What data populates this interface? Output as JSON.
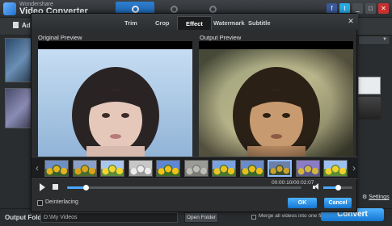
{
  "app": {
    "brand_small": "Wondershare",
    "brand_big": "Video Converter",
    "toolbar": {
      "add_files_label": "Add Fil"
    }
  },
  "editor": {
    "tabs": [
      "Trim",
      "Crop",
      "Effect",
      "Watermark",
      "Subtitle"
    ],
    "active_tab": "Effect",
    "original_label": "Original Preview",
    "output_label": "Output Preview",
    "timecode": "00:00:10/00:02:07",
    "playback_progress": 0.08,
    "volume_level": 0.5,
    "deinterlace_label": "Deinterlacing",
    "ok_label": "OK",
    "cancel_label": "Cancel"
  },
  "effects": [
    "sunflower-blue-sky-effect",
    "sunflower-warm-effect",
    "sunflower-bright-effect",
    "gray-emboss-effect",
    "sunflower-vivid-effect",
    "sketch-effect",
    "sunflower-normal-effect",
    "sunflower-cool-effect",
    "sunflower-selected-effect",
    "sunflower-purple-effect",
    "sunflower-bright-2-effect"
  ],
  "bottom_bar": {
    "output_folder_label": "Output Folder",
    "output_folder_value": "D:\\My Videos",
    "open_folder_label": "Open Folder",
    "merge_label": "Merge all videos into one file",
    "convert_label": "Convert",
    "settings_label": "Settings"
  },
  "colors": {
    "accent": "#1f7fd6",
    "background": "#2b2d2f"
  }
}
